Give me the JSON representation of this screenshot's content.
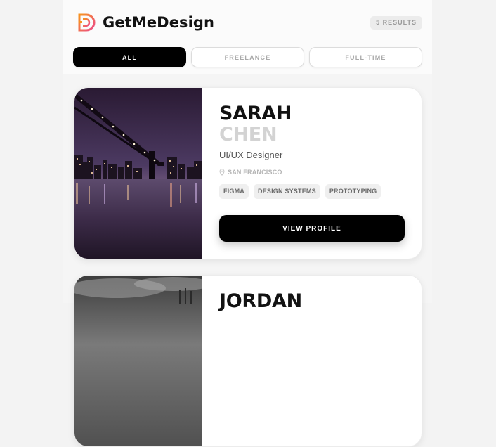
{
  "header": {
    "brand": "GetMeDesign",
    "logo_icon": "gmd-logo-icon",
    "results": "5 RESULTS"
  },
  "tabs": [
    {
      "label": "ALL",
      "active": true
    },
    {
      "label": "FREELANCE",
      "active": false
    },
    {
      "label": "FULL-TIME",
      "active": false
    }
  ],
  "cards": [
    {
      "first_name": "SARAH",
      "last_name": "CHEN",
      "role": "UI/UX Designer",
      "location": "SAN FRANCISCO",
      "skills": [
        "FIGMA",
        "DESIGN SYSTEMS",
        "PROTOTYPING"
      ],
      "button": "VIEW PROFILE",
      "photo": "night-bridge-cityscape"
    },
    {
      "first_name": "JORDAN",
      "photo": "cloudy-landscape-grayscale"
    }
  ],
  "colors": {
    "accent": "#000000",
    "logo_orange": "#f7931e",
    "logo_pink": "#ec4a8a",
    "muted_name": "#d3d3d3"
  }
}
